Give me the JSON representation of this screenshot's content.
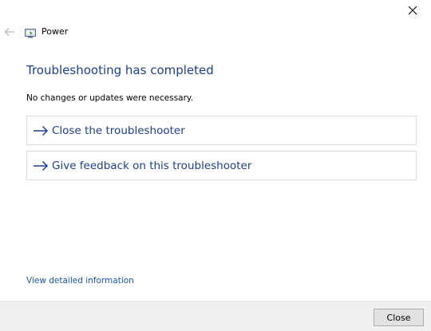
{
  "window": {
    "app_title": "Power",
    "close_icon": "close-icon",
    "back_icon": "back-arrow-icon",
    "app_icon": "power-troubleshooter-icon"
  },
  "main": {
    "heading": "Troubleshooting has completed",
    "subtext": "No changes or updates were necessary.",
    "actions": [
      {
        "icon": "arrow-right-icon",
        "label": "Close the troubleshooter"
      },
      {
        "icon": "arrow-right-icon",
        "label": "Give feedback on this troubleshooter"
      }
    ],
    "detail_link": "View detailed information"
  },
  "footer": {
    "close_label": "Close"
  },
  "colors": {
    "accent_text": "#1e3f8c",
    "link_text": "#1a55b0",
    "footer_bg": "#f0f0f0"
  }
}
